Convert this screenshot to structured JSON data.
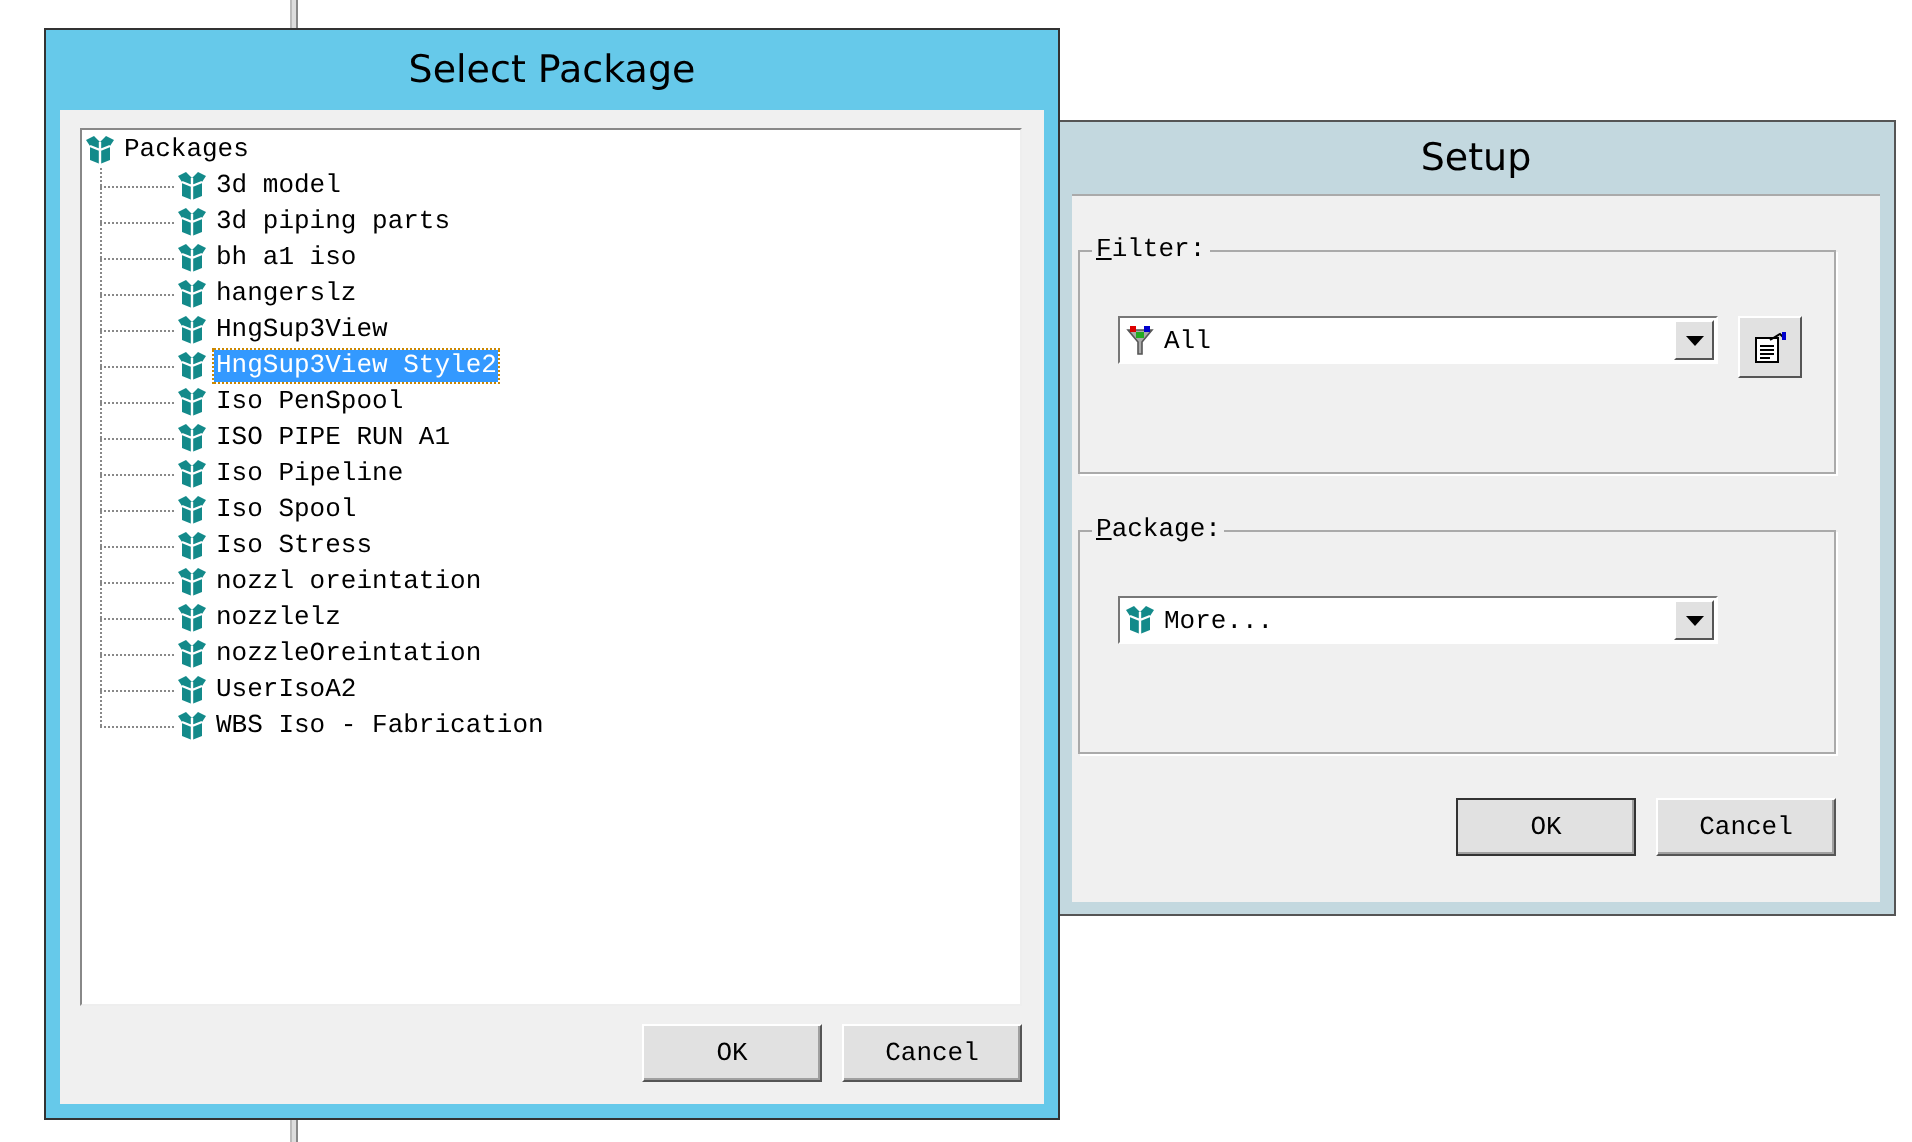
{
  "select_package": {
    "title": "Select Package",
    "tree": {
      "label": "Packages",
      "selected": false,
      "children": [
        {
          "label": "3d model",
          "selected": false
        },
        {
          "label": "3d piping parts",
          "selected": false
        },
        {
          "label": "bh a1 iso",
          "selected": false
        },
        {
          "label": "hangerslz",
          "selected": false
        },
        {
          "label": "HngSup3View",
          "selected": false
        },
        {
          "label": "HngSup3View Style2",
          "selected": true
        },
        {
          "label": "Iso PenSpool",
          "selected": false
        },
        {
          "label": "ISO PIPE RUN A1",
          "selected": false
        },
        {
          "label": "Iso Pipeline",
          "selected": false
        },
        {
          "label": "Iso Spool",
          "selected": false
        },
        {
          "label": "Iso Stress",
          "selected": false
        },
        {
          "label": "nozzl oreintation",
          "selected": false
        },
        {
          "label": "nozzlelz",
          "selected": false
        },
        {
          "label": "nozzleOreintation",
          "selected": false
        },
        {
          "label": "UserIsoA2",
          "selected": false
        },
        {
          "label": "WBS Iso - Fabrication",
          "selected": false
        }
      ]
    },
    "buttons": [
      "OK",
      "Cancel"
    ]
  },
  "setup": {
    "title": "Setup",
    "groups": [
      {
        "label": "Filter:",
        "combo": {
          "kind": "funnel",
          "value": "All"
        },
        "side_button": true
      },
      {
        "label": "Package:",
        "combo": {
          "kind": "package",
          "value": "More..."
        },
        "side_button": false
      }
    ],
    "buttons": [
      "OK",
      "Cancel"
    ]
  }
}
